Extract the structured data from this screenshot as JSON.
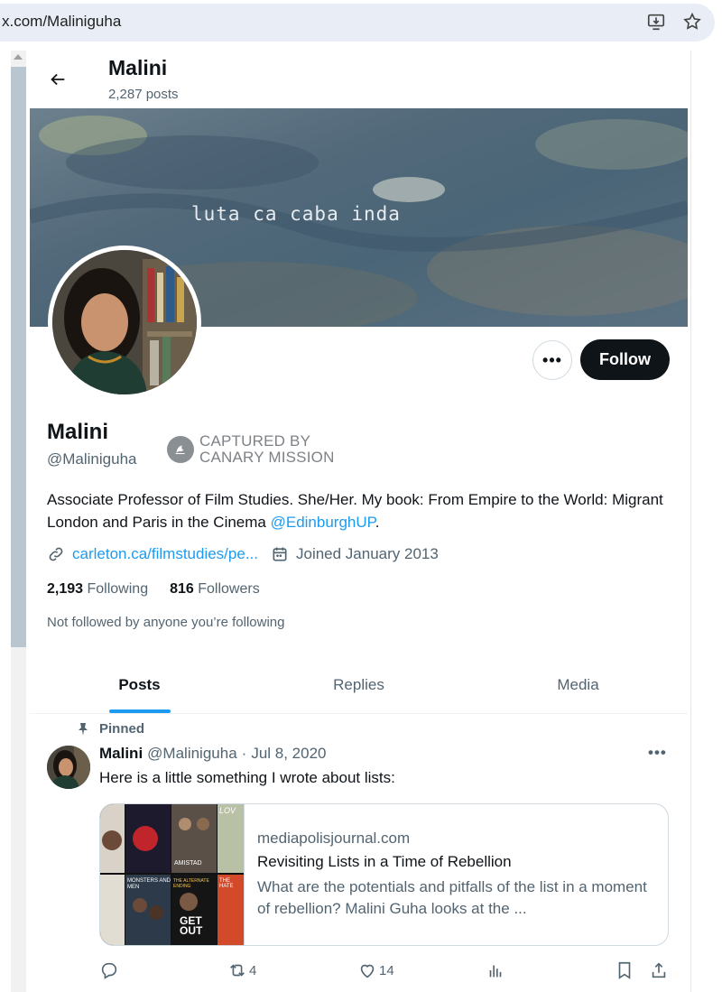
{
  "browser": {
    "url": "x.com/Maliniguha",
    "icons": [
      "install-app-icon",
      "bookmark-star-icon"
    ]
  },
  "header": {
    "name": "Malini",
    "posts": "2,287 posts"
  },
  "banner": {
    "text": "luta ca caba inda"
  },
  "actions": {
    "more": "•••",
    "follow": "Follow"
  },
  "profile": {
    "name": "Malini",
    "handle": "@Maliniguha",
    "badge_line1": "CAPTURED BY",
    "badge_line2": "CANARY MISSION",
    "bio_text": "Associate Professor of Film Studies. She/Her. My book: From Empire to the World: Migrant London and Paris in the Cinema ",
    "bio_link": "@EdinburghUP",
    "bio_end": ".",
    "website": "carleton.ca/filmstudies/pe...",
    "joined": "Joined January 2013",
    "following_count": "2,193",
    "following_label": "Following",
    "followers_count": "816",
    "followers_label": "Followers",
    "not_followed": "Not followed by anyone you’re following"
  },
  "tabs": [
    {
      "label": "Posts",
      "active": true
    },
    {
      "label": "Replies",
      "active": false
    },
    {
      "label": "Media",
      "active": false
    }
  ],
  "tweet": {
    "pinned_label": "Pinned",
    "name": "Malini",
    "handle": "@Maliniguha",
    "dot": "·",
    "date": "Jul 8, 2020",
    "more": "•••",
    "text": "Here is a little something I wrote about lists:",
    "card": {
      "domain": "mediapolisjournal.com",
      "title": "Revisiting Lists in a Time of Rebellion",
      "description": "What are the potentials and pitfalls of the list in a moment of rebellion? Malini Guha looks at the ...",
      "poster_labels": [
        "LOV",
        "AMISTAD",
        "MONSTERS AND MEN",
        "THE ALTERNATE ENDING",
        "GET OUT",
        "THE HATE"
      ]
    },
    "retweets": "4",
    "likes": "14"
  },
  "colors": {
    "accent": "#1d9bf0",
    "text_primary": "#0f1419",
    "text_secondary": "#536471",
    "follow_bg": "#0f1419"
  }
}
